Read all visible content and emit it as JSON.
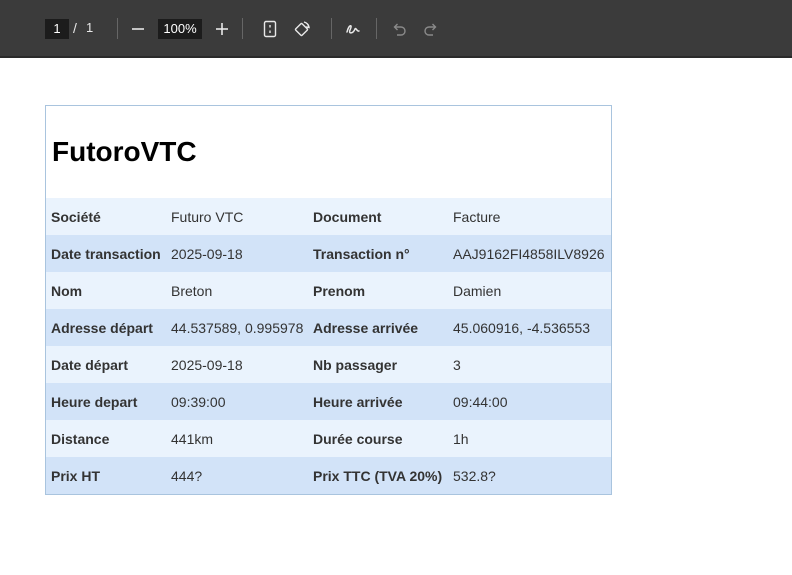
{
  "toolbar": {
    "page_current": "1",
    "page_separator": "/",
    "page_total": "1",
    "zoom": "100%",
    "icons": [
      "zoom-out-icon",
      "zoom-in-icon",
      "fit-page-icon",
      "rotate-icon",
      "draw-icon",
      "undo-icon",
      "redo-icon"
    ]
  },
  "document": {
    "title": "FutoroVTC",
    "rows": [
      {
        "label1": "Société",
        "value1": "Futuro VTC",
        "label2": "Document",
        "value2": "Facture"
      },
      {
        "label1": "Date transaction",
        "value1": "2025-09-18",
        "label2": "Transaction n°",
        "value2": "AAJ9162FI4858ILV8926"
      },
      {
        "label1": "Nom",
        "value1": "Breton",
        "label2": "Prenom",
        "value2": "Damien"
      },
      {
        "label1": "Adresse départ",
        "value1": "44.537589, 0.995978",
        "label2": "Adresse arrivée",
        "value2": "45.060916, -4.536553"
      },
      {
        "label1": "Date départ",
        "value1": "2025-09-18",
        "label2": "Nb passager",
        "value2": "3"
      },
      {
        "label1": "Heure depart",
        "value1": "09:39:00",
        "label2": "Heure arrivée",
        "value2": "09:44:00"
      },
      {
        "label1": "Distance",
        "value1": "441km",
        "label2": "Durée course",
        "value2": "1h"
      },
      {
        "label1": "Prix HT",
        "value1": "444?",
        "label2": "Prix TTC (TVA 20%)",
        "value2": "532.8?"
      }
    ]
  },
  "colors": {
    "toolbar_bg": "#3b3b3b",
    "row_light": "#eaf3fd",
    "row_dark": "#d2e3f8",
    "doc_border": "#a9c4de"
  }
}
